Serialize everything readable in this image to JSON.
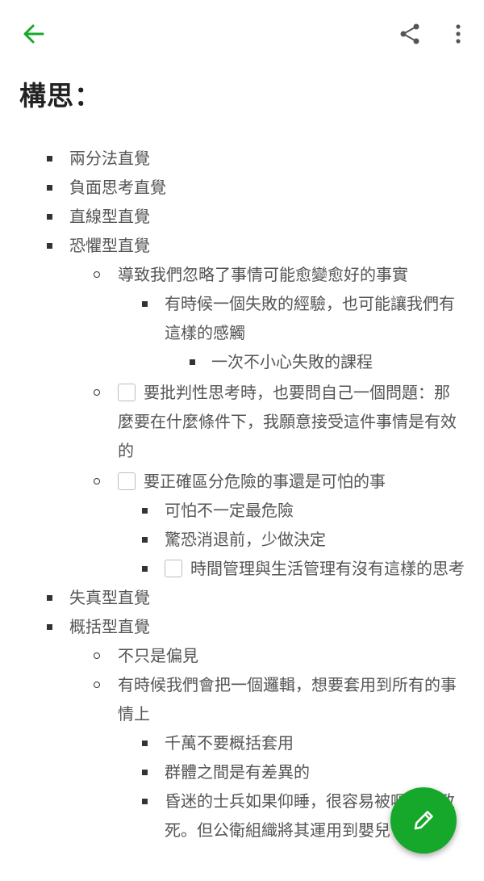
{
  "toolbar": {
    "back_icon": "arrow-left-icon",
    "share_icon": "share-icon",
    "more_icon": "more-vertical-icon",
    "accent_color": "#16a82a"
  },
  "note": {
    "title": "構思：",
    "items": {
      "i1": "兩分法直覺",
      "i2": "負面思考直覺",
      "i3": "直線型直覺",
      "i4": "恐懼型直覺",
      "i4_1": "導致我們忽略了事情可能愈變愈好的事實",
      "i4_1_1": "有時候一個失敗的經驗，也可能讓我們有這樣的感觸",
      "i4_1_1_1": "一次不小心失敗的課程",
      "i4_2": "要批判性思考時，也要問自己一個問題：那麼要在什麼條件下，我願意接受這件事情是有效的",
      "i4_3": "要正確區分危險的事還是可怕的事",
      "i4_3_1": "可怕不一定最危險",
      "i4_3_2": "驚恐消退前，少做決定",
      "i4_3_3": "時間管理與生活管理有沒有這樣的思考",
      "i5": "失真型直覺",
      "i6": "概括型直覺",
      "i6_1": "不只是偏見",
      "i6_2": "有時候我們會把一個邏輯，想要套用到所有的事情上",
      "i6_2_1": "千萬不要概括套用",
      "i6_2_2": "群體之間是有差異的",
      "i6_2_3": "昏迷的士兵如果仰睡，很容易被嘔吐物致死。但公衛組織將其運用到嬰兒"
    }
  },
  "fab": {
    "icon": "pencil-icon"
  }
}
